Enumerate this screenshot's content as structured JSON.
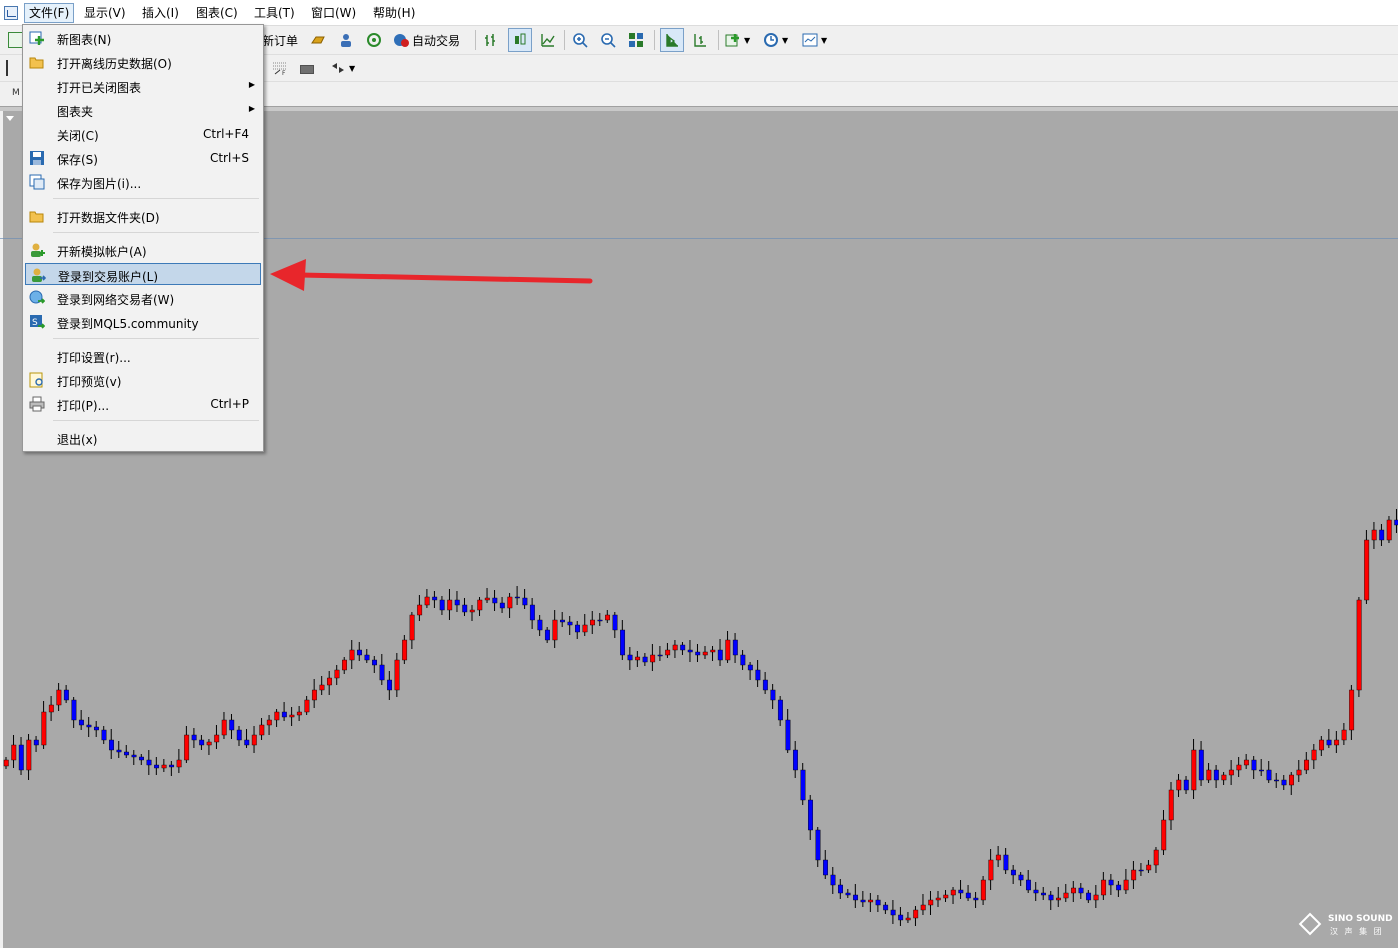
{
  "menubar": {
    "items": [
      {
        "label": "文件(F)",
        "active": true
      },
      {
        "label": "显示(V)"
      },
      {
        "label": "插入(I)"
      },
      {
        "label": "图表(C)"
      },
      {
        "label": "工具(T)"
      },
      {
        "label": "窗口(W)"
      },
      {
        "label": "帮助(H)"
      }
    ]
  },
  "toolbar": {
    "new_order_label": "新订单",
    "auto_trade_label": "自动交易",
    "left_stub_label": "M"
  },
  "file_menu": {
    "items": [
      {
        "label": "新图表(N)",
        "icon": "new-chart-icon"
      },
      {
        "label": "打开离线历史数据(O)",
        "icon": "open-folder-icon"
      },
      {
        "label": "打开已关闭图表",
        "submenu": true
      },
      {
        "label": "图表夹",
        "submenu": true
      },
      {
        "label": "关闭(C)",
        "shortcut": "Ctrl+F4"
      },
      {
        "label": "保存(S)",
        "shortcut": "Ctrl+S",
        "icon": "save-icon"
      },
      {
        "label": "保存为图片(i)...",
        "icon": "save-picture-icon"
      },
      {
        "label": "打开数据文件夹(D)",
        "icon": "data-folder-icon"
      },
      {
        "label": "开新模拟帐户(A)",
        "icon": "demo-account-icon"
      },
      {
        "label": "登录到交易账户(L)",
        "icon": "login-trade-icon",
        "highlighted": true
      },
      {
        "label": "登录到网络交易者(W)",
        "icon": "web-trader-icon"
      },
      {
        "label": "登录到MQL5.community",
        "icon": "mql5-icon"
      },
      {
        "label": "打印设置(r)..."
      },
      {
        "label": "打印预览(v)",
        "icon": "print-preview-icon"
      },
      {
        "label": "打印(P)...",
        "shortcut": "Ctrl+P",
        "icon": "printer-icon"
      },
      {
        "label": "退出(x)"
      }
    ]
  },
  "watermark": {
    "brand": "SINO SOUND",
    "sub": "汉 声 集 团"
  },
  "colors": {
    "chart_bg": "#a9a9a9",
    "bull": "#ff0000",
    "bear": "#0000ff",
    "wick": "#000000",
    "arrow": "#e8262b",
    "highlight": "#c4d7ea"
  },
  "chart_data": {
    "type": "candlestick",
    "note_axis": "",
    "closes": [
      760,
      745,
      770,
      740,
      745,
      712,
      705,
      690,
      700,
      720,
      725,
      727,
      730,
      740,
      750,
      752,
      755,
      757,
      760,
      765,
      768,
      765,
      767,
      760,
      735,
      740,
      745,
      742,
      735,
      720,
      730,
      740,
      745,
      735,
      725,
      720,
      712,
      717,
      715,
      712,
      700,
      690,
      685,
      678,
      670,
      660,
      650,
      655,
      660,
      665,
      680,
      690,
      660,
      640,
      615,
      605,
      597,
      600,
      610,
      600,
      605,
      612,
      610,
      600,
      598,
      603,
      608,
      597,
      598,
      605,
      620,
      630,
      640,
      620,
      622,
      625,
      632,
      625,
      620,
      620,
      615,
      630,
      655,
      660,
      657,
      662,
      655,
      655,
      650,
      645,
      650,
      652,
      655,
      652,
      650,
      660,
      640,
      655,
      665,
      670,
      680,
      690,
      700,
      720,
      750,
      770,
      800,
      830,
      860,
      875,
      885,
      893,
      895,
      900,
      902,
      900,
      905,
      910,
      915,
      920,
      918,
      910,
      905,
      900,
      898,
      895,
      890,
      893,
      898,
      900,
      880,
      860,
      855,
      870,
      875,
      880,
      890,
      893,
      895,
      900,
      898,
      893,
      888,
      893,
      900,
      895,
      880,
      885,
      890,
      880,
      870,
      870,
      865,
      850,
      820,
      790,
      780,
      790,
      750,
      780,
      770,
      780,
      775,
      770,
      765,
      760,
      770,
      770,
      780,
      780,
      785,
      775,
      770,
      760,
      750,
      740,
      745,
      740,
      730,
      690,
      600,
      540,
      530,
      540,
      520,
      525
    ]
  }
}
